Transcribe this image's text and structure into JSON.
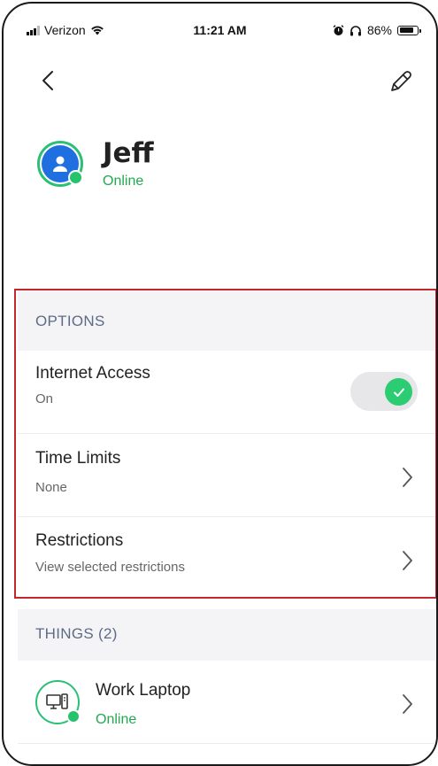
{
  "status_bar": {
    "carrier": "Verizon",
    "time": "11:21 AM",
    "battery_text": "86%",
    "battery_level": 0.86,
    "icons": [
      "signal-icon",
      "wifi-icon",
      "alarm-icon",
      "headphones-icon",
      "battery-icon"
    ]
  },
  "header": {
    "back_icon": "chevron-left-icon",
    "edit_icon": "pencil-icon"
  },
  "profile": {
    "name": "Jeff",
    "status": "Online",
    "avatar_icon": "user-icon",
    "status_color": "#22a94f"
  },
  "options": {
    "header": "OPTIONS",
    "internet_access": {
      "title": "Internet Access",
      "value": "On",
      "enabled": true
    },
    "time_limits": {
      "title": "Time Limits",
      "value": "None"
    },
    "restrictions": {
      "title": "Restrictions",
      "value": "View selected restrictions"
    }
  },
  "things": {
    "header": "THINGS (2)",
    "items": [
      {
        "name": "Work Laptop",
        "status": "Online",
        "icon": "computer-icon"
      }
    ]
  },
  "colors": {
    "accent_green": "#2ccc72",
    "avatar_blue": "#1f6fe0",
    "section_header_bg": "#f4f4f6",
    "section_header_text": "#5d6b85",
    "highlight_red": "#c0282d"
  }
}
